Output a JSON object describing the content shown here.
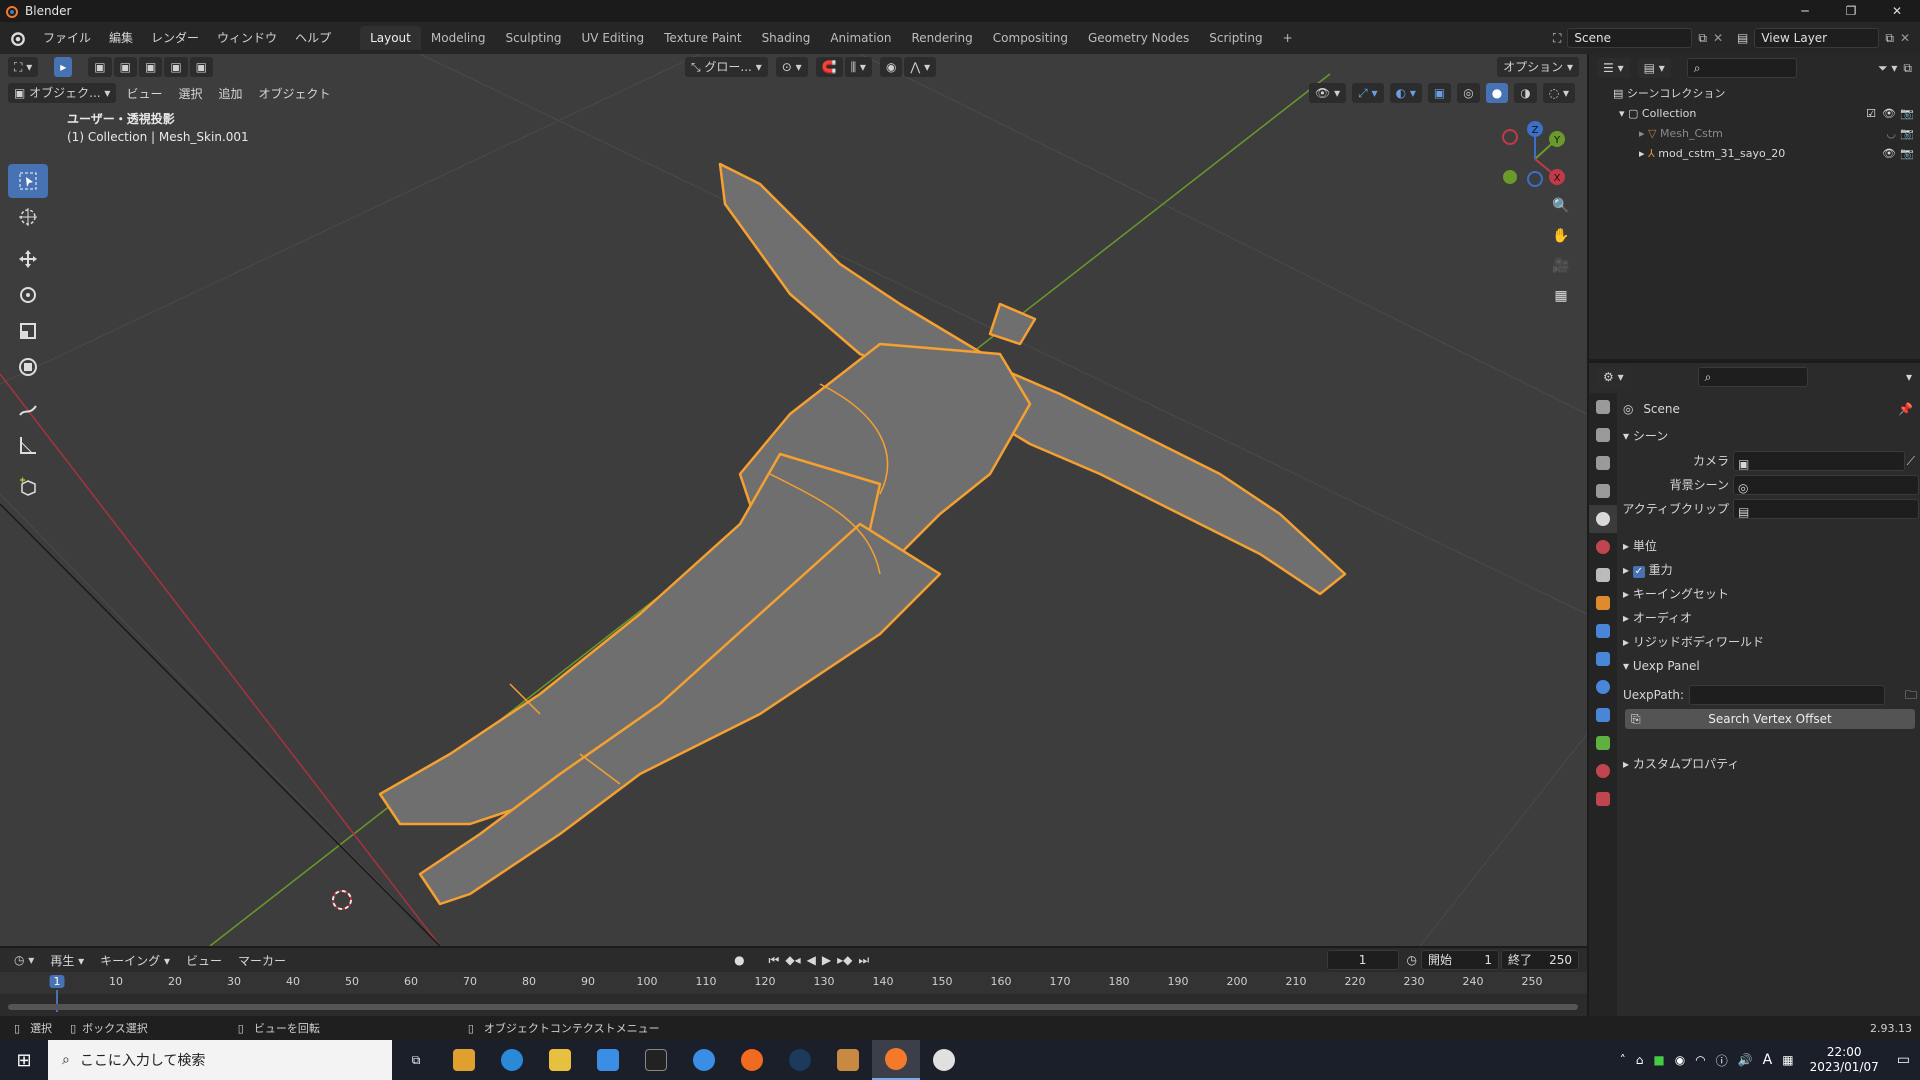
{
  "window": {
    "title": "Blender",
    "buttons": [
      "─",
      "❐",
      "✕"
    ]
  },
  "menu": [
    "ファイル",
    "編集",
    "レンダー",
    "ウィンドウ",
    "ヘルプ"
  ],
  "workspaces": [
    "Layout",
    "Modeling",
    "Sculpting",
    "UV Editing",
    "Texture Paint",
    "Shading",
    "Animation",
    "Rendering",
    "Compositing",
    "Geometry Nodes",
    "Scripting"
  ],
  "active_workspace": "Layout",
  "scene_field": "Scene",
  "view_layer_field": "View Layer",
  "viewport": {
    "mode": "オブジェク...",
    "menus": [
      "ビュー",
      "選択",
      "追加",
      "オブジェクト"
    ],
    "transform_orientation": "グロー...",
    "options_label": "オプション",
    "view_name": "ユーザー・透視投影",
    "collection_info": "(1) Collection | Mesh_Skin.001",
    "gizmo_axes": [
      "X",
      "Y",
      "Z"
    ]
  },
  "outliner": {
    "root": "シーンコレクション",
    "collection": "Collection",
    "items": [
      "Mesh_Cstm",
      "mod_cstm_31_sayo_20"
    ]
  },
  "properties": {
    "scene_name": "Scene",
    "section_scene": "シーン",
    "fields": [
      {
        "label": "カメラ"
      },
      {
        "label": "背景シーン"
      },
      {
        "label": "アクティブクリップ"
      }
    ],
    "sections": [
      "単位",
      "重力",
      "キーイングセット",
      "オーディオ",
      "リジッドボディワールド",
      "Uexp Panel"
    ],
    "uexp_path_label": "UexpPath:",
    "search_button": "Search Vertex Offset",
    "custom_props": "カスタムプロパティ"
  },
  "timeline": {
    "menus": [
      "再生",
      "キーイング",
      "ビュー",
      "マーカー"
    ],
    "current_frame": "1",
    "start_label": "開始",
    "start_value": "1",
    "end_label": "終了",
    "end_value": "250",
    "ticks": [
      "1",
      "10",
      "20",
      "30",
      "40",
      "50",
      "60",
      "70",
      "80",
      "90",
      "100",
      "110",
      "120",
      "130",
      "140",
      "150",
      "160",
      "170",
      "180",
      "190",
      "200",
      "210",
      "220",
      "230",
      "240",
      "250"
    ]
  },
  "statusbar": {
    "select": "選択",
    "box_select": "ボックス選択",
    "rotate_view": "ビューを回転",
    "context_menu": "オブジェクトコンテクストメニュー",
    "version": "2.93.13"
  },
  "taskbar": {
    "search_placeholder": "ここに入力して検索",
    "time": "22:00",
    "date": "2023/01/07",
    "ime": "A"
  },
  "colors": {
    "accent": "#4772b3",
    "selection_outline": "#f5a030",
    "viewport_bg": "#3d3d3d",
    "axis_x": "#c23a4a",
    "axis_y": "#6a9a2a"
  }
}
